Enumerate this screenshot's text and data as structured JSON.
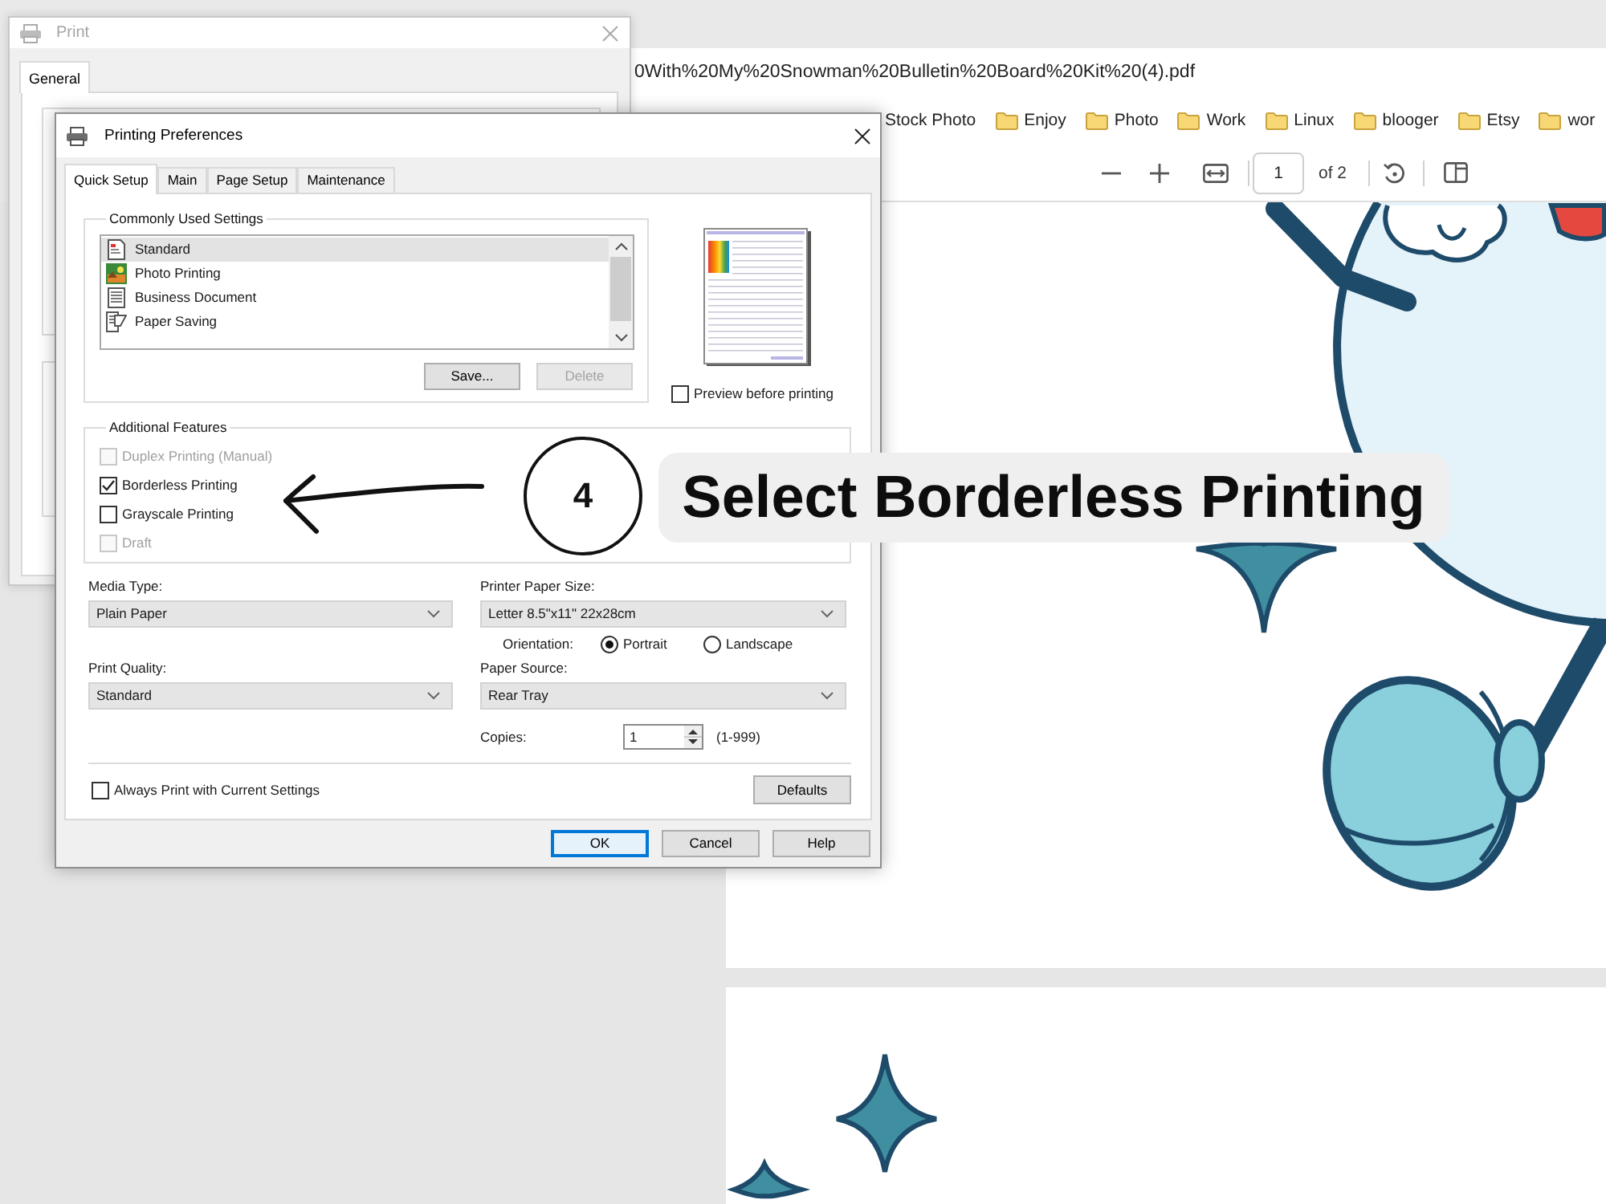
{
  "browser": {
    "address_bar": {
      "url": "0With%20My%20Snowman%20Bulletin%20Board%20Kit%20(4).pdf"
    },
    "bookmarks": [
      {
        "label": "Stock Photo",
        "folder_icon": false
      },
      {
        "label": "Enjoy",
        "folder_icon": true
      },
      {
        "label": "Photo",
        "folder_icon": true
      },
      {
        "label": "Work",
        "folder_icon": true
      },
      {
        "label": "Linux",
        "folder_icon": true
      },
      {
        "label": "blooger",
        "folder_icon": true
      },
      {
        "label": "Etsy",
        "folder_icon": true
      },
      {
        "label": "wor",
        "folder_icon": true
      }
    ],
    "pdf_toolbar": {
      "page": "1",
      "page_count": "of 2"
    }
  },
  "print_window": {
    "title": "Print",
    "tabs": [
      {
        "label": "General",
        "selected": true
      }
    ]
  },
  "preferences_window": {
    "title": "Printing Preferences",
    "tabs": [
      {
        "label": "Quick Setup",
        "selected": true
      },
      {
        "label": "Main",
        "selected": false
      },
      {
        "label": "Page Setup",
        "selected": false
      },
      {
        "label": "Maintenance",
        "selected": false
      }
    ],
    "commonly_used_settings": {
      "title": "Commonly Used Settings",
      "items": [
        {
          "label": "Standard",
          "kind": "standard",
          "selected": true
        },
        {
          "label": "Photo Printing",
          "kind": "photo",
          "selected": false
        },
        {
          "label": "Business Document",
          "kind": "business",
          "selected": false
        },
        {
          "label": "Paper Saving",
          "kind": "paper_saving",
          "selected": false
        }
      ],
      "buttons": [
        {
          "label": "Save...",
          "disabled": false
        },
        {
          "label": "Delete",
          "disabled": true
        }
      ]
    },
    "preview": {
      "label": "Preview before printing",
      "checked": false
    },
    "additional_features": {
      "title": "Additional Features",
      "options": [
        {
          "label": "Duplex Printing (Manual)",
          "checked": false,
          "disabled": true
        },
        {
          "label": "Borderless Printing",
          "checked": true,
          "disabled": false
        },
        {
          "label": "Grayscale Printing",
          "checked": false,
          "disabled": false
        },
        {
          "label": "Draft",
          "checked": false,
          "disabled": true
        }
      ]
    },
    "media_type": {
      "label": "Media Type:",
      "value": "Plain Paper"
    },
    "printer_paper_size": {
      "label": "Printer Paper Size:",
      "value": "Letter 8.5\"x11\" 22x28cm"
    },
    "orientation": {
      "label": "Orientation:",
      "options": [
        {
          "label": "Portrait",
          "selected": true
        },
        {
          "label": "Landscape",
          "selected": false
        }
      ]
    },
    "print_quality": {
      "label": "Print Quality:",
      "value": "Standard"
    },
    "paper_source": {
      "label": "Paper Source:",
      "value": "Rear Tray"
    },
    "copies": {
      "label": "Copies:",
      "value": "1",
      "range": "(1-999)"
    },
    "always_print": {
      "label": "Always Print with Current Settings",
      "checked": false
    },
    "defaults_button": "Defaults",
    "buttons": [
      {
        "label": "OK",
        "focused": true
      },
      {
        "label": "Cancel",
        "focused": false
      },
      {
        "label": "Help",
        "focused": false
      }
    ]
  },
  "annotation": {
    "step": "4",
    "text": "Select Borderless Printing"
  }
}
